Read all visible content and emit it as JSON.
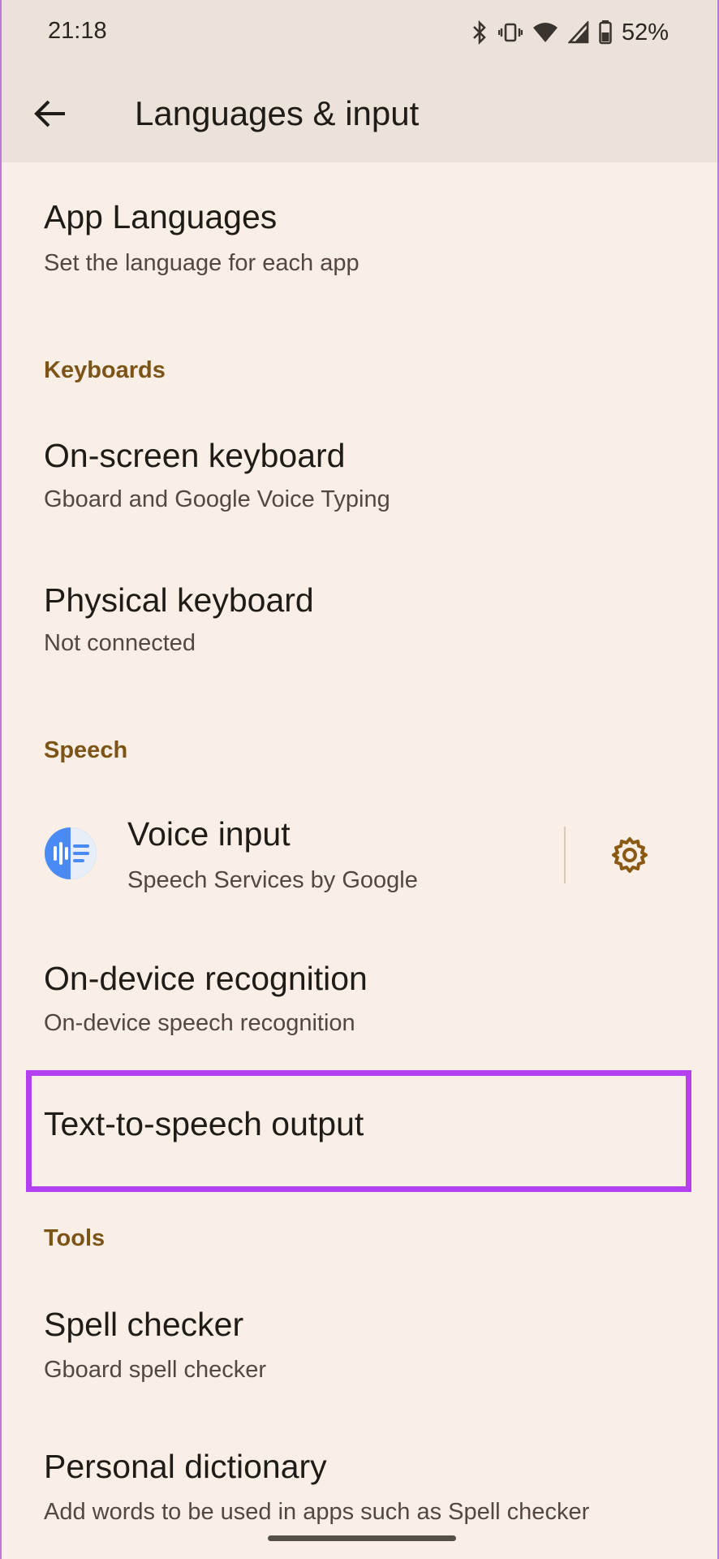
{
  "status_bar": {
    "time": "21:18",
    "battery": "52%",
    "icons": [
      "bluetooth-icon",
      "vibrate-icon",
      "wifi-icon",
      "signal-icon",
      "battery-icon"
    ]
  },
  "app_bar": {
    "title": "Languages & input",
    "back_icon": "arrow-back-icon"
  },
  "items": {
    "app_languages": {
      "title": "App Languages",
      "subtitle": "Set the language for each app"
    },
    "keyboards_header": "Keyboards",
    "onscreen_keyboard": {
      "title": "On-screen keyboard",
      "subtitle": "Gboard and Google Voice Typing"
    },
    "physical_keyboard": {
      "title": "Physical keyboard",
      "subtitle": "Not connected"
    },
    "speech_header": "Speech",
    "voice_input": {
      "title": "Voice input",
      "subtitle": "Speech Services by Google",
      "settings_icon": "gear-icon"
    },
    "ondevice_recognition": {
      "title": "On-device recognition",
      "subtitle": "On-device speech recognition"
    },
    "tts_output": {
      "title": "Text-to-speech output"
    },
    "tools_header": "Tools",
    "spell_checker": {
      "title": "Spell checker",
      "subtitle": "Gboard spell checker"
    },
    "personal_dictionary": {
      "title": "Personal dictionary",
      "subtitle": "Add words to be used in apps such as Spell checker"
    }
  },
  "colors": {
    "background": "#faefe6",
    "app_bar": "#ebe2da",
    "section_header": "#7d5417",
    "highlight": "#b340f2",
    "accent_gear": "#8a5a14"
  }
}
